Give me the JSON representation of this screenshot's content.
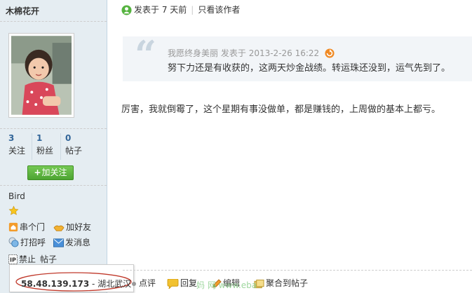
{
  "sidebar": {
    "username": "木棉花开",
    "stats": [
      {
        "value": "3",
        "label": "关注"
      },
      {
        "value": "1",
        "label": "粉丝"
      },
      {
        "value": "0",
        "label": "帖子"
      }
    ],
    "follow_button": "加关注",
    "group": "Bird",
    "actions": [
      {
        "label": "串个门",
        "icon": "home-icon"
      },
      {
        "label": "加好友",
        "icon": "add-friend-icon"
      },
      {
        "label": "打招呼",
        "icon": "greet-icon"
      },
      {
        "label": "发消息",
        "icon": "mail-icon"
      },
      {
        "label": "禁止",
        "icon": "ip-icon"
      },
      {
        "label": "帖子",
        "icon": ""
      }
    ],
    "ip_tooltip": {
      "ip": "58.48.139.173",
      "separator": " - ",
      "location": "湖北武汉"
    }
  },
  "header": {
    "posted": "发表于 7 天前",
    "only_author": "只看该作者"
  },
  "quote": {
    "author": "我愿终身美丽",
    "posted_prefix": "发表于",
    "timestamp": "2013-2-26 16:22",
    "text": "努下力还是有收获的，这两天炒金战绩。转运珠还没到，运气先到了。"
  },
  "post": {
    "text": "厉害，我就倒霉了，这个星期有事没做单，都是赚钱的，上周做的基本上都亏。"
  },
  "footer": {
    "rate": "点评",
    "reply": "回复",
    "edit": "编辑",
    "aggregate": "聚合到帖子"
  },
  "watermark": "妈 网 www.eba",
  "colors": {
    "sidebar_bg": "#e5edf2",
    "link": "#336699",
    "green_button": "#4da432",
    "oval": "#c0392b"
  }
}
